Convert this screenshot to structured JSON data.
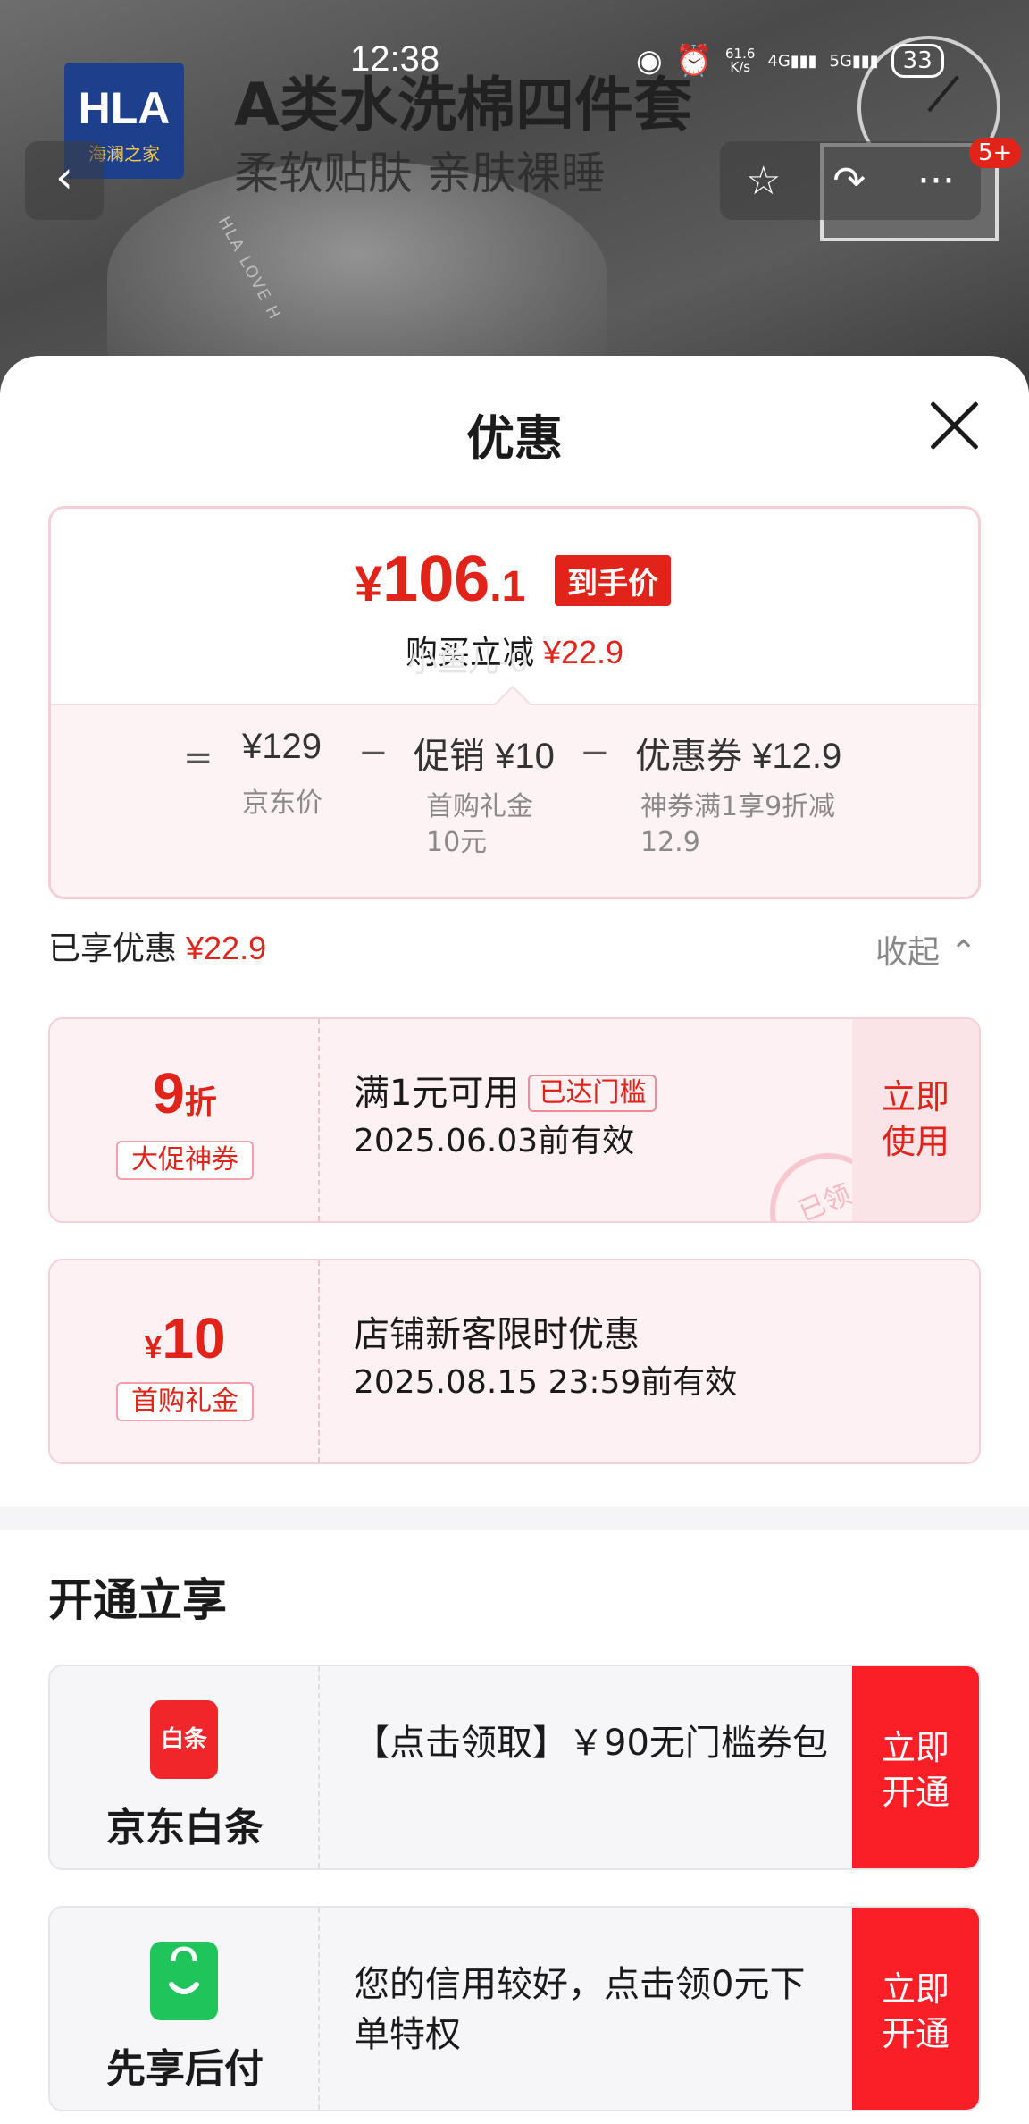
{
  "status_bar": {
    "time": "12:38",
    "net_speed_top": "61.6",
    "net_speed_bottom": "K/s",
    "sig1": "4G",
    "sig2": "5G",
    "battery": "33"
  },
  "backdrop": {
    "brand_logo_top": "HLA",
    "brand_logo_bottom": "海澜之家",
    "promo_title": "A类水洗棉四件套",
    "promo_subtitle": "柔软贴肤 亲肤裸睡",
    "pillow_text": "HLA LOVE H",
    "more_badge": "5+"
  },
  "sheet": {
    "title": "优惠",
    "final_price": {
      "currency": "¥",
      "integer": "106",
      "decimal": ".1",
      "tag": "到手价"
    },
    "reduce": {
      "label": "购买立减",
      "amount": "¥22.9"
    },
    "calc": {
      "eq": "=",
      "base_value": "¥129",
      "base_label": "京东价",
      "op1": "−",
      "promo_value": "促销 ¥10",
      "promo_sub1": "首购礼金",
      "promo_sub2": "10元",
      "op2": "−",
      "coupon_value": "优惠券 ¥12.9",
      "coupon_sub1": "神券满1享9折减",
      "coupon_sub2": "12.9"
    },
    "enjoyed": {
      "label": "已享优惠",
      "amount": "¥22.9"
    },
    "collapse_label": "收起",
    "watermark": "小鱼儿-0"
  },
  "coupons": [
    {
      "value": "9",
      "unit": "折",
      "tag": "大促神券",
      "condition": "满1元可用",
      "condition_tag": "已达门槛",
      "validity": "2025.06.03前有效",
      "btn_line1": "立即",
      "btn_line2": "使用",
      "stamp": "已领"
    },
    {
      "currency": "¥",
      "value": "10",
      "tag": "首购礼金",
      "condition": "店铺新客限时优惠",
      "validity": "2025.08.15 23:59前有效"
    }
  ],
  "open_section": {
    "title": "开通立享",
    "items": [
      {
        "icon_text": "白条",
        "name": "京东白条",
        "desc": "【点击领取】￥90无门槛券包",
        "btn_line1": "立即",
        "btn_line2": "开通"
      },
      {
        "icon_text": "",
        "name": "先享后付",
        "desc": "您的信用较好，点击领0元下单特权",
        "btn_line1": "立即",
        "btn_line2": "开通"
      }
    ]
  },
  "colors": {
    "accent_red": "#e2231a",
    "open_btn_red": "#fa1f27",
    "coupon_bg": "#fdf1f3",
    "baitiao_red": "#f0262b",
    "paylater_green": "#1fc45a"
  }
}
